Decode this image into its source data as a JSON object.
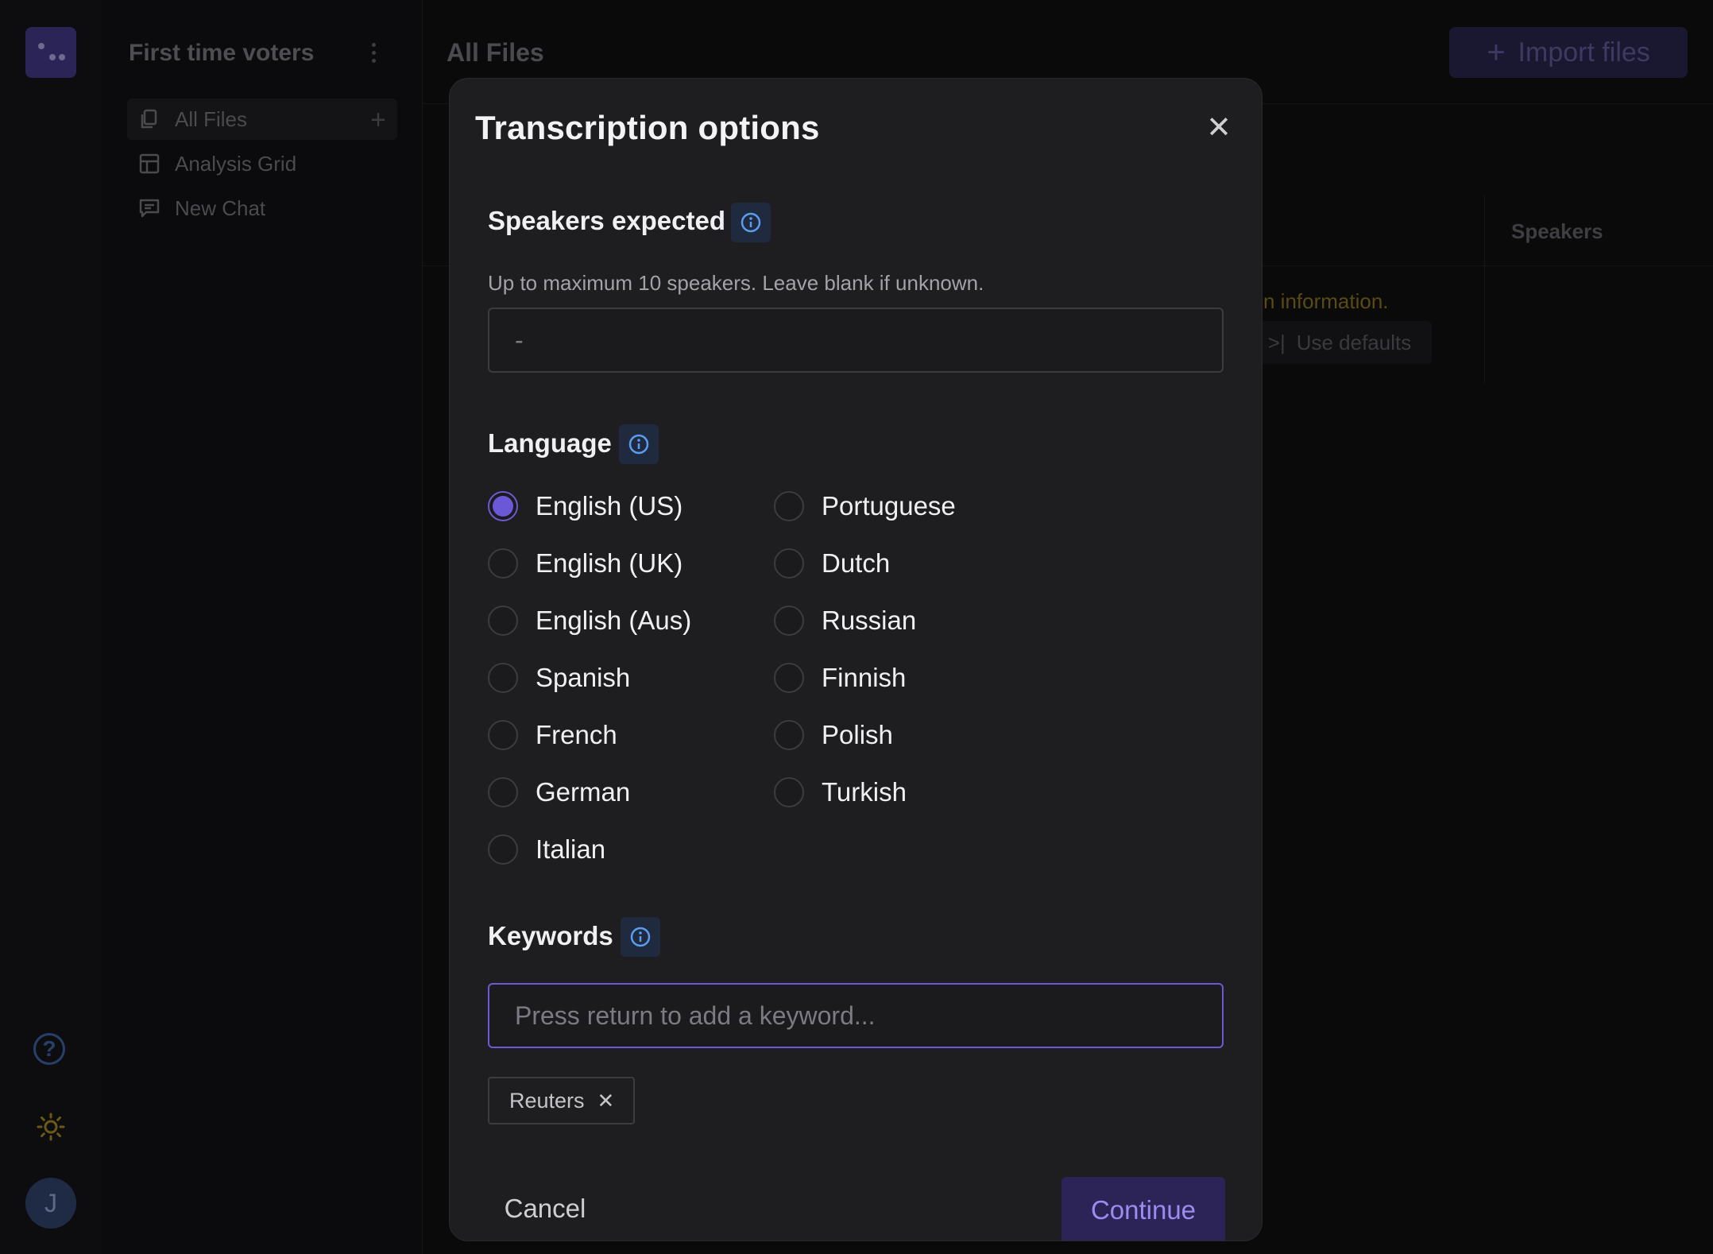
{
  "app": {
    "project_title": "First time voters",
    "nav": [
      {
        "label": "All Files",
        "icon": "files-icon"
      },
      {
        "label": "Analysis Grid",
        "icon": "grid-icon"
      },
      {
        "label": "New Chat",
        "icon": "chat-icon"
      }
    ],
    "avatar_initial": "J",
    "help_glyph": "?",
    "main_title": "All Files",
    "import_button": "Import files",
    "table_header_speakers": "Speakers",
    "info_message": "n information.",
    "use_defaults": "Use defaults"
  },
  "modal": {
    "title": "Transcription options",
    "speakers": {
      "label": "Speakers expected",
      "hint": "Up to maximum 10 speakers. Leave blank if unknown.",
      "placeholder": "-"
    },
    "language": {
      "label": "Language",
      "selected": "English (US)",
      "options_col1": [
        "English (US)",
        "English (UK)",
        "English (Aus)",
        "Spanish",
        "French",
        "German",
        "Italian"
      ],
      "options_col2": [
        "Portuguese",
        "Dutch",
        "Russian",
        "Finnish",
        "Polish",
        "Turkish"
      ]
    },
    "keywords": {
      "label": "Keywords",
      "placeholder": "Press return to add a keyword...",
      "tags": [
        "Reuters"
      ]
    },
    "cancel_label": "Cancel",
    "continue_label": "Continue"
  },
  "colors": {
    "accent": "#6a58d6",
    "info_icon": "#5b9cf0",
    "modal_bg": "#1e1e21"
  }
}
